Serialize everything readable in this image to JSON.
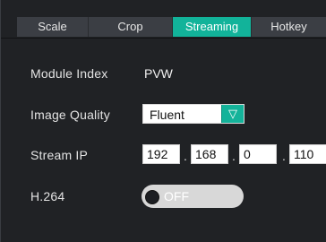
{
  "tabs": [
    {
      "label": "Scale"
    },
    {
      "label": "Crop"
    },
    {
      "label": "Streaming",
      "active": true
    },
    {
      "label": "Hotkey"
    }
  ],
  "fields": {
    "module_index": {
      "label": "Module Index",
      "value": "PVW"
    },
    "image_quality": {
      "label": "Image Quality",
      "selected": "Fluent",
      "dropdown_icon": "▽"
    },
    "stream_ip": {
      "label": "Stream IP",
      "octets": [
        "192",
        "168",
        "0",
        "110"
      ],
      "separator": "."
    },
    "h264": {
      "label": "H.264",
      "toggle_text": "OFF",
      "enabled": false
    }
  },
  "colors": {
    "background": "#202225",
    "tab_active": "#12b39a",
    "tab_inactive": "#3b3e44",
    "accent": "#14b39a",
    "toggle_off": "#d8d8d8"
  }
}
